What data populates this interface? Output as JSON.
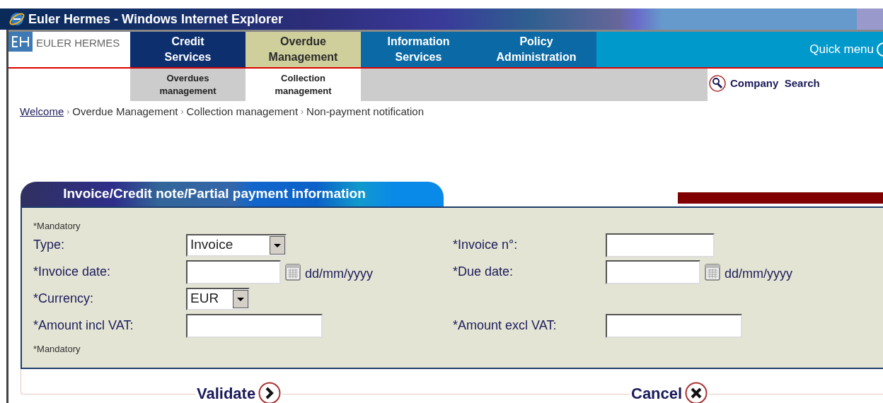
{
  "window": {
    "title": "Euler Hermes - Windows Internet Explorer"
  },
  "logo": {
    "text": "EULER HERMES"
  },
  "nav": [
    {
      "label": "Credit Services",
      "selected": false
    },
    {
      "label": "Overdue Management",
      "selected": true
    },
    {
      "label": "Information Services",
      "selected": false
    },
    {
      "label": "Policy Administration",
      "selected": false
    }
  ],
  "quick_menu": "Quick menu",
  "subnav": [
    {
      "label": "Overdues management",
      "selected": false
    },
    {
      "label": "Collection management",
      "selected": true
    }
  ],
  "company_search": [
    "Company",
    "Search"
  ],
  "breadcrumb_separator": "›",
  "breadcrumb": [
    {
      "label": "Welcome",
      "link": true
    },
    {
      "label": "Overdue Management",
      "link": false
    },
    {
      "label": "Collection management",
      "link": false
    },
    {
      "label": "Non-payment notification",
      "link": false
    }
  ],
  "panel": {
    "title": "Invoice/Credit note/Partial payment information",
    "mandatory_top": "*Mandatory",
    "mandatory_bottom": "*Mandatory",
    "left": [
      {
        "label": "Type:",
        "kind": "select",
        "value": "Invoice"
      },
      {
        "label": "*Invoice date:",
        "kind": "date",
        "hint": "dd/mm/yyyy"
      },
      {
        "label": "*Currency:",
        "kind": "select",
        "value": "EUR"
      },
      {
        "label": "*Amount incl VAT:",
        "kind": "text"
      }
    ],
    "right": [
      {
        "label": "*Invoice n°:",
        "kind": "text"
      },
      {
        "label": "*Due date:",
        "kind": "date",
        "hint": "dd/mm/yyyy"
      },
      {
        "kind": "blank"
      },
      {
        "label": "*Amount excl VAT:",
        "kind": "text"
      }
    ]
  },
  "buttons": [
    {
      "label": "Validate",
      "kind": "next"
    },
    {
      "label": "Cancel",
      "kind": "cancel"
    }
  ]
}
